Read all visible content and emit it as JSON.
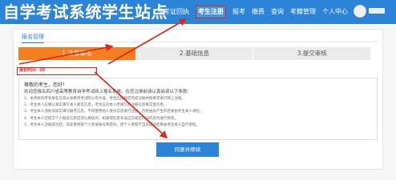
{
  "header": {
    "site_title": "自学考试系统学生站点",
    "nav": [
      {
        "label": "准考证回执"
      },
      {
        "label": "考生注册"
      },
      {
        "label": "报考"
      },
      {
        "label": "缴费"
      },
      {
        "label": "查询"
      },
      {
        "label": "考籍管理"
      },
      {
        "label": "个人中心"
      }
    ],
    "active_nav_index": 1
  },
  "panel": {
    "title": "报名管理"
  },
  "steps": [
    {
      "label": "1.注意事项"
    },
    {
      "label": "2.基础信息"
    },
    {
      "label": "3.提交审核"
    }
  ],
  "reg_time": "报名时间：20",
  "notice": {
    "greeting": "尊敬的考生，您好！",
    "intro": "欢迎您报名四川省高等教育自学考试网上报名系统。在您注册前请认真阅读以下条款：",
    "rules": [
      "1、本系统的所有报名信息以省教育考试院公布为准，考生应按规定完成注册并按要求进行网上注册。",
      "2、考生本人应确认真实填写本人真实信息，考生应对本人所填写的注册信息真实性负责。",
      "3、考生本人须依法如实填写报考信息，不得使用他人身份信息进行注册，否则由此产生的后果由考生本人承担。",
      "4、考生本人在提交个人报名信息后须认真核对，如发现信息有误应在规定时间内及时进行修改。",
      "5、考生本人注册成功后，须妥善保管个人登录账号和密码，因个人保管不当造成的后果由考生本人自行承担。"
    ]
  },
  "agree_button": "同意并继续",
  "colors": {
    "brand_blue": "#2c84d8",
    "step_active_orange": "#f57f1e",
    "annotation_red": "#e2231a"
  }
}
